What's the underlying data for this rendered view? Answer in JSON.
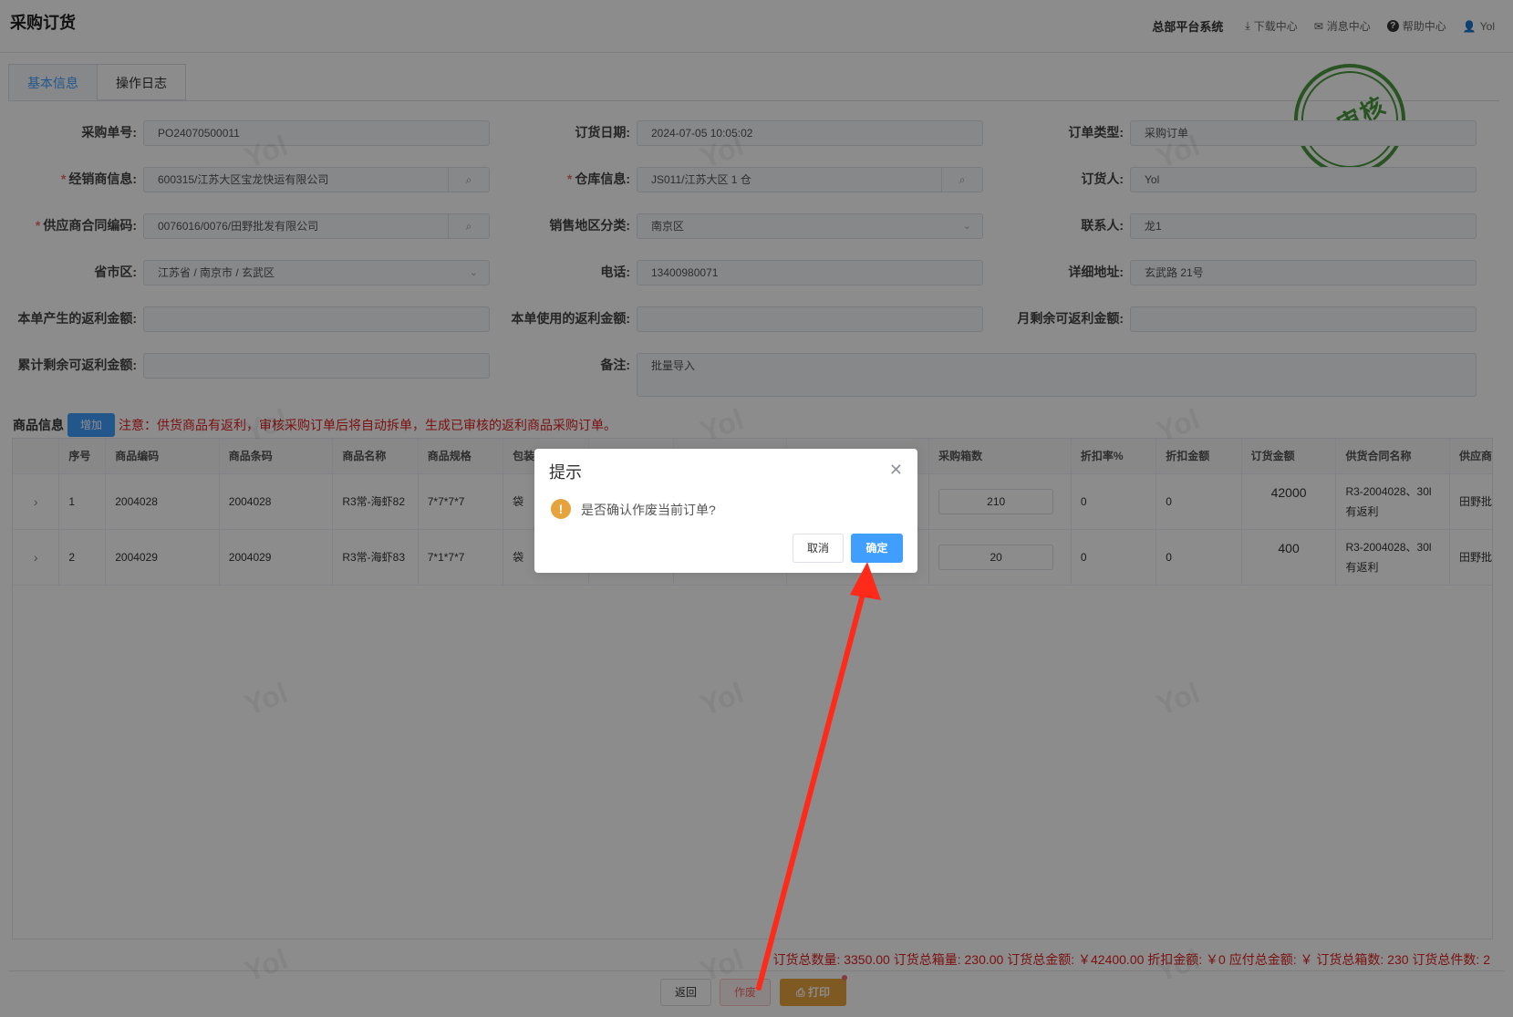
{
  "header": {
    "title": "采购订货",
    "system": "总部平台系统",
    "download": "下载中心",
    "messages": "消息中心",
    "help": "帮助中心",
    "user": "Yol"
  },
  "tabs": [
    "基本信息",
    "操作日志"
  ],
  "stamp": "已审核",
  "watermark": "Yol",
  "form": {
    "order_no_label": "采购单号:",
    "order_no": "PO24070500011",
    "order_date_label": "订货日期:",
    "order_date": "2024-07-05 10:05:02",
    "order_type_label": "订单类型:",
    "order_type": "采购订单",
    "dealer_label": "经销商信息:",
    "dealer": "600315/江苏大区宝龙快运有限公司",
    "warehouse_label": "仓库信息:",
    "warehouse": "JS011/江苏大区 1 仓",
    "orderer_label": "订货人:",
    "orderer": "Yol",
    "supplier_contract_label": "供应商合同编码:",
    "supplier_contract": "0076016/0076/田野批发有限公司",
    "sales_region_label": "销售地区分类:",
    "sales_region": "南京区",
    "contact_label": "联系人:",
    "contact": "龙1",
    "province_label": "省市区:",
    "province": "江苏省 / 南京市 / 玄武区",
    "phone_label": "电话:",
    "phone": "13400980071",
    "address_label": "详细地址:",
    "address": "玄武路 21号",
    "rebate_generated_label": "本单产生的返利金额:",
    "rebate_generated": "",
    "rebate_used_label": "本单使用的返利金额:",
    "rebate_used": "",
    "monthly_rebate_label": "月剩余可返利金额:",
    "monthly_rebate": "",
    "total_rebate_label": "累计剩余可返利金额:",
    "total_rebate": "",
    "remark_label": "备注:",
    "remark": "批量导入"
  },
  "goods": {
    "label": "商品信息",
    "add_button": "增加",
    "notice": "注意：供货商品有返利，审核采购订单后将自动拆单，生成已审核的返利商品采购订单。",
    "columns": [
      "",
      "序号",
      "商品编码",
      "商品条码",
      "商品名称",
      "商品规格",
      "包装单位",
      "",
      "",
      "",
      "采购箱数",
      "折扣率%",
      "折扣金额",
      "订货金额",
      "供货合同名称",
      "供应商"
    ],
    "rows": [
      {
        "seq": "1",
        "code": "2004028",
        "barcode": "2004028",
        "name": "R3常-海虾82",
        "spec": "7*7*7*7",
        "unit": "袋",
        "boxes": "210",
        "discount_rate": "0",
        "discount_amount": "0",
        "amount": "42000",
        "contract": "R3-2004028、30l 有返利",
        "supplier": "田野批发有限公司"
      },
      {
        "seq": "2",
        "code": "2004029",
        "barcode": "2004029",
        "name": "R3常-海虾83",
        "spec": "7*1*7*7",
        "unit": "袋",
        "boxes": "20",
        "discount_rate": "0",
        "discount_amount": "0",
        "amount": "400",
        "contract": "R3-2004028、30l 有返利",
        "supplier": "田野批发有限公司"
      }
    ]
  },
  "summary": "订货总数量: 3350.00   订货总箱量: 230.00   订货总金额: ￥42400.00   折扣金额: ￥0   应付总金额: ￥   订货总箱数: 230   订货总件数: 2",
  "footer": {
    "back": "返回",
    "void": "作废",
    "print": "打印"
  },
  "dialog": {
    "title": "提示",
    "message": "是否确认作废当前订单?",
    "cancel": "取消",
    "confirm": "确定"
  },
  "colors": {
    "primary": "#409eff",
    "danger": "#f56c6c",
    "warning": "#e6a23c",
    "stamp": "#4a9a3f",
    "annotation_arrow": "#ff2a1a"
  },
  "icons": {
    "download": "download-icon",
    "messages": "mail-icon",
    "help": "question-circle-icon",
    "user": "user-icon",
    "search": "search-icon",
    "dropdown": "chevron-down-icon",
    "expand": "chevron-right-icon",
    "close": "close-icon",
    "warning": "warning-icon",
    "print": "printer-icon"
  }
}
